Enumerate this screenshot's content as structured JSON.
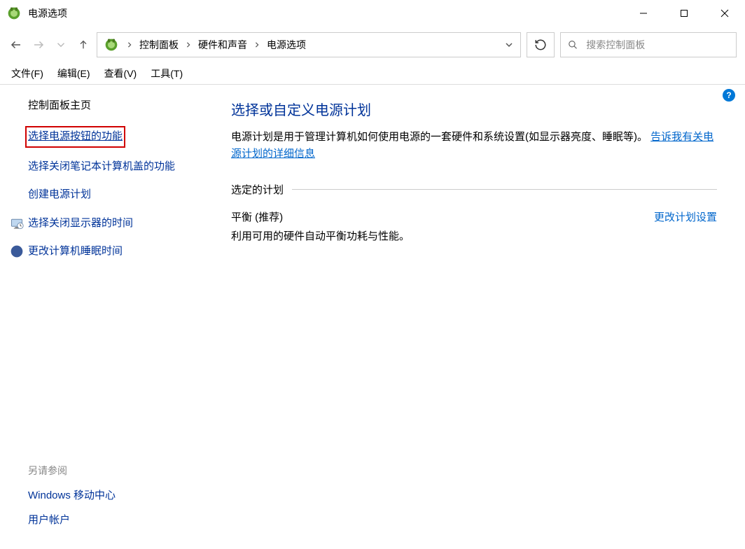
{
  "window": {
    "title": "电源选项"
  },
  "breadcrumb": {
    "items": [
      "控制面板",
      "硬件和声音",
      "电源选项"
    ]
  },
  "search": {
    "placeholder": "搜索控制面板"
  },
  "menu": {
    "file": "文件(F)",
    "edit": "编辑(E)",
    "view": "查看(V)",
    "tools": "工具(T)"
  },
  "sidebar": {
    "home": "控制面板主页",
    "links": {
      "power_button": "选择电源按钮的功能",
      "close_lid": "选择关闭笔记本计算机盖的功能",
      "create_plan": "创建电源计划",
      "display_off": "选择关闭显示器的时间",
      "sleep_time": "更改计算机睡眠时间"
    },
    "see_also": {
      "header": "另请参阅",
      "mobility": "Windows 移动中心",
      "accounts": "用户帐户"
    }
  },
  "main": {
    "heading": "选择或自定义电源计划",
    "desc_1": "电源计划是用于管理计算机如何使用电源的一套硬件和系统设置(如显示器亮度、睡眠等)。",
    "more_info_link": "告诉我有关电源计划的详细信息",
    "selected_plan_label": "选定的计划",
    "plan": {
      "name": "平衡 (推荐)",
      "change_link": "更改计划设置",
      "desc": "利用可用的硬件自动平衡功耗与性能。"
    }
  }
}
